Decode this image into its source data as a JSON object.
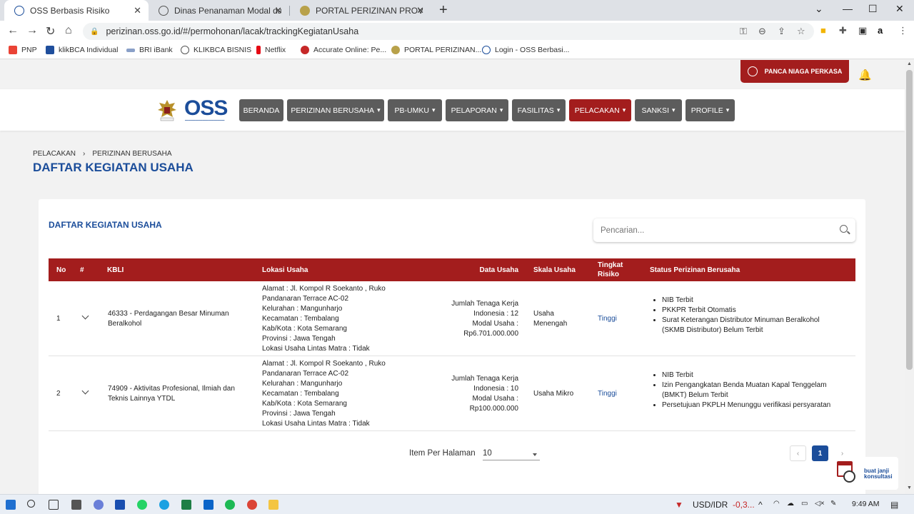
{
  "browser": {
    "tabs": [
      {
        "title": "OSS Berbasis Risiko",
        "active": true
      },
      {
        "title": "Dinas Penanaman Modal dan Pe",
        "active": false
      },
      {
        "title": "PORTAL PERIZINAN PROV JAWA",
        "active": false
      }
    ],
    "url": "perizinan.oss.go.id/#/permohonan/lacak/trackingKegiatanUsaha",
    "bookmarks": [
      "PNP",
      "klikBCA Individual",
      "BRI iBank",
      "KLIKBCA BISNIS",
      "Netflix",
      "Accurate Online: Pe...",
      "PORTAL PERIZINAN...",
      "Login - OSS Berbasi..."
    ]
  },
  "topbar": {
    "user_label": "PANCA NIAGA PERKASA"
  },
  "header": {
    "logo_text": "OSS",
    "menu": [
      {
        "label": "BERANDA",
        "dropdown": false,
        "active": false
      },
      {
        "label": "PERIZINAN BERUSAHA",
        "dropdown": true,
        "active": false
      },
      {
        "label": "PB-UMKU",
        "dropdown": true,
        "active": false
      },
      {
        "label": "PELAPORAN",
        "dropdown": true,
        "active": false
      },
      {
        "label": "FASILITAS",
        "dropdown": true,
        "active": false
      },
      {
        "label": "PELACAKAN",
        "dropdown": true,
        "active": true
      },
      {
        "label": "SANKSI",
        "dropdown": true,
        "active": false
      },
      {
        "label": "PROFILE",
        "dropdown": true,
        "active": false
      }
    ]
  },
  "breadcrumb": {
    "first": "PELACAKAN",
    "second": "PERIZINAN BERUSAHA"
  },
  "page_title": "DAFTAR KEGIATAN USAHA",
  "card": {
    "title": "DAFTAR KEGIATAN USAHA",
    "search_placeholder": "Pencarian..."
  },
  "table": {
    "headers": {
      "no": "No",
      "hash": "#",
      "kbli": "KBLI",
      "lokasi": "Lokasi Usaha",
      "data": "Data Usaha",
      "skala": "Skala Usaha",
      "risiko_1": "Tingkat",
      "risiko_2": "Risiko",
      "status": "Status Perizinan Berusaha"
    },
    "rows": [
      {
        "no": "1",
        "kbli": "46333 - Perdagangan Besar Minuman Beralkohol",
        "lokasi": [
          "Alamat : Jl. Kompol R Soekanto , Ruko",
          "Pandanaran Terrace AC-02",
          "Kelurahan : Mangunharjo",
          "Kecamatan : Tembalang",
          "Kab/Kota : Kota Semarang",
          "Provinsi : Jawa Tengah",
          "Lokasi Usaha Lintas Matra : Tidak"
        ],
        "data": [
          "Jumlah Tenaga Kerja",
          "Indonesia : 12",
          "Modal Usaha :",
          "Rp6.701.000.000"
        ],
        "skala": [
          "Usaha",
          "Menengah"
        ],
        "risiko": "Tinggi",
        "status": [
          "NIB Terbit",
          "PKKPR Terbit Otomatis",
          "Surat Keterangan Distributor Minuman Beralkohol (SKMB Distributor) Belum Terbit"
        ]
      },
      {
        "no": "2",
        "kbli": "74909 - Aktivitas Profesional, Ilmiah dan Teknis Lainnya YTDL",
        "lokasi": [
          "Alamat : Jl. Kompol R Soekanto , Ruko",
          "Pandanaran Terrace AC-02",
          "Kelurahan : Mangunharjo",
          "Kecamatan : Tembalang",
          "Kab/Kota : Kota Semarang",
          "Provinsi : Jawa Tengah",
          "Lokasi Usaha Lintas Matra : Tidak"
        ],
        "data": [
          "Jumlah Tenaga Kerja",
          "Indonesia : 10",
          "Modal Usaha :",
          "Rp100.000.000"
        ],
        "skala": [
          "Usaha Mikro"
        ],
        "risiko": "Tinggi",
        "status": [
          "NIB Terbit",
          "Izin Pengangkatan Benda Muatan Kapal Tenggelam (BMKT) Belum Terbit",
          "Persetujuan PKPLH Menunggu verifikasi persyaratan"
        ]
      }
    ]
  },
  "pagination": {
    "label": "Item Per Halaman",
    "per_page": "10",
    "current_page": "1"
  },
  "konsultasi": {
    "label": "buat janji konsultasi"
  },
  "taskbar": {
    "ticker": "USD/IDR",
    "ticker_value": "-0,3...",
    "time": "9:49 AM"
  }
}
